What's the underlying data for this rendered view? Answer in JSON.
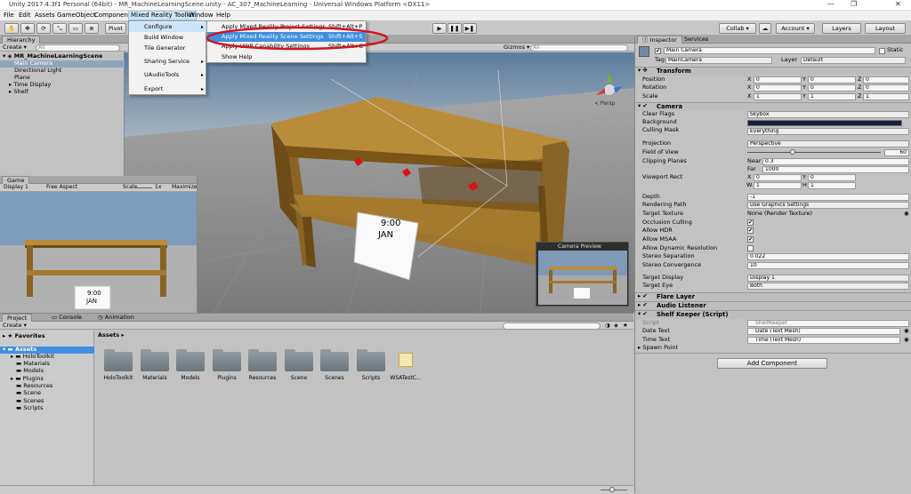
{
  "titlebar": {
    "title": "Unity 2017.4.3f1 Personal (64bit) - MR_MachineLearningScene.unity - AC_307_MachineLearning - Universal Windows Platform <DX11>",
    "min": "—",
    "max": "❐",
    "close": "✕"
  },
  "menu": [
    "File",
    "Edit",
    "Assets",
    "GameObject",
    "Component",
    "Mixed Reality Toolkit",
    "Window",
    "Help"
  ],
  "mrtk_menu": {
    "items": [
      "Configure",
      "Build Window",
      "Tile Generator",
      "Sharing Service",
      "UAudioTools",
      "Export"
    ]
  },
  "configure_submenu": [
    {
      "label": "Apply Mixed Reality Project Settings",
      "shortcut": "Shift+Alt+P"
    },
    {
      "label": "Apply Mixed Reality Scene Settings",
      "shortcut": "Shift+Alt+S"
    },
    {
      "label": "Apply UWP Capability Settings",
      "shortcut": "Shift+Alt+C"
    },
    {
      "label": "Show Help",
      "shortcut": ""
    }
  ],
  "toolbar": {
    "pivot": "Pivot",
    "collab": "Collab ▾",
    "account": "Account ▾",
    "layers": "Layers",
    "layout": "Layout"
  },
  "hierarchy": {
    "tab": "Hierarchy",
    "create": "Create ▾",
    "search": "All",
    "scene": "MR_MachineLearningScene",
    "items": [
      "Main Camera",
      "Directional Light",
      "Plane",
      "Time Display",
      "Shelf"
    ]
  },
  "scene_view": {
    "gizmos": "Gizmos ▾",
    "search": "All",
    "persp": "< Persp",
    "sign_time": "9:00",
    "sign_month": "JAN",
    "camera_preview": "Camera Preview"
  },
  "game_view": {
    "tab": "Game",
    "display": "Display 1",
    "aspect": "Free Aspect",
    "scale_label": "Scale",
    "scale_val": "1x",
    "maximize": "Maximize",
    "sign_time": "9:00",
    "sign_month": "JAN"
  },
  "project": {
    "tabs": [
      "Project",
      "Console",
      "Animation"
    ],
    "create": "Create ▾",
    "favorites": "Favorites",
    "assets_root": "Assets",
    "tree": [
      "HoloToolkit",
      "Materials",
      "Models",
      "Plugins",
      "Resources",
      "Scene",
      "Scenes",
      "Scripts"
    ],
    "breadcrumb": "Assets ▸",
    "folders": [
      "HoloToolkit",
      "Materials",
      "Models",
      "Plugins",
      "Resources",
      "Scene",
      "Scenes",
      "Scripts"
    ],
    "file": "WSATestC..."
  },
  "inspector": {
    "tabs": [
      "Inspector",
      "Services"
    ],
    "name": "Main Camera",
    "static": "Static",
    "tag_label": "Tag",
    "tag": "MainCamera",
    "layer_label": "Layer",
    "layer": "Default",
    "transform": {
      "title": "Transform",
      "rows": [
        {
          "label": "Position",
          "x": "0",
          "y": "0",
          "z": "0"
        },
        {
          "label": "Rotation",
          "x": "0",
          "y": "0",
          "z": "0"
        },
        {
          "label": "Scale",
          "x": "1",
          "y": "1",
          "z": "1"
        }
      ]
    },
    "camera": {
      "title": "Camera",
      "clear_flags": {
        "label": "Clear Flags",
        "value": "Skybox"
      },
      "background": {
        "label": "Background"
      },
      "culling": {
        "label": "Culling Mask",
        "value": "Everything"
      },
      "projection": {
        "label": "Projection",
        "value": "Perspective"
      },
      "fov": {
        "label": "Field of View",
        "value": "60"
      },
      "clipping": {
        "label": "Clipping Planes",
        "near_label": "Near",
        "near": "0.3",
        "far_label": "Far",
        "far": "1000"
      },
      "viewport": {
        "label": "Viewport Rect",
        "x": "0",
        "y": "0",
        "w": "1",
        "h": "1"
      },
      "depth": {
        "label": "Depth",
        "value": "-1"
      },
      "rendering": {
        "label": "Rendering Path",
        "value": "Use Graphics Settings"
      },
      "target_texture": {
        "label": "Target Texture",
        "value": "None (Render Texture)"
      },
      "occlusion": {
        "label": "Occlusion Culling"
      },
      "hdr": {
        "label": "Allow HDR"
      },
      "msaa": {
        "label": "Allow MSAA"
      },
      "dynres": {
        "label": "Allow Dynamic Resolution"
      },
      "stereo_sep": {
        "label": "Stereo Separation",
        "value": "0.022"
      },
      "stereo_conv": {
        "label": "Stereo Convergence",
        "value": "10"
      },
      "target_display": {
        "label": "Target Display",
        "value": "Display 1"
      },
      "target_eye": {
        "label": "Target Eye",
        "value": "Both"
      }
    },
    "flare": "Flare Layer",
    "audio": "Audio Listener",
    "shelf": {
      "title": "Shelf Keeper (Script)",
      "script_label": "Script",
      "script": "ShelfKeeper",
      "date_label": "Date Text",
      "date": "Date (Text Mesh)",
      "time_label": "Time Text",
      "time": "Time (Text Mesh)",
      "spawn": "Spawn Point"
    },
    "add_component": "Add Component"
  },
  "colors": {
    "highlight": "#3f8fe0",
    "annotation": "#d0141e",
    "shelf": "#a57a2c"
  }
}
